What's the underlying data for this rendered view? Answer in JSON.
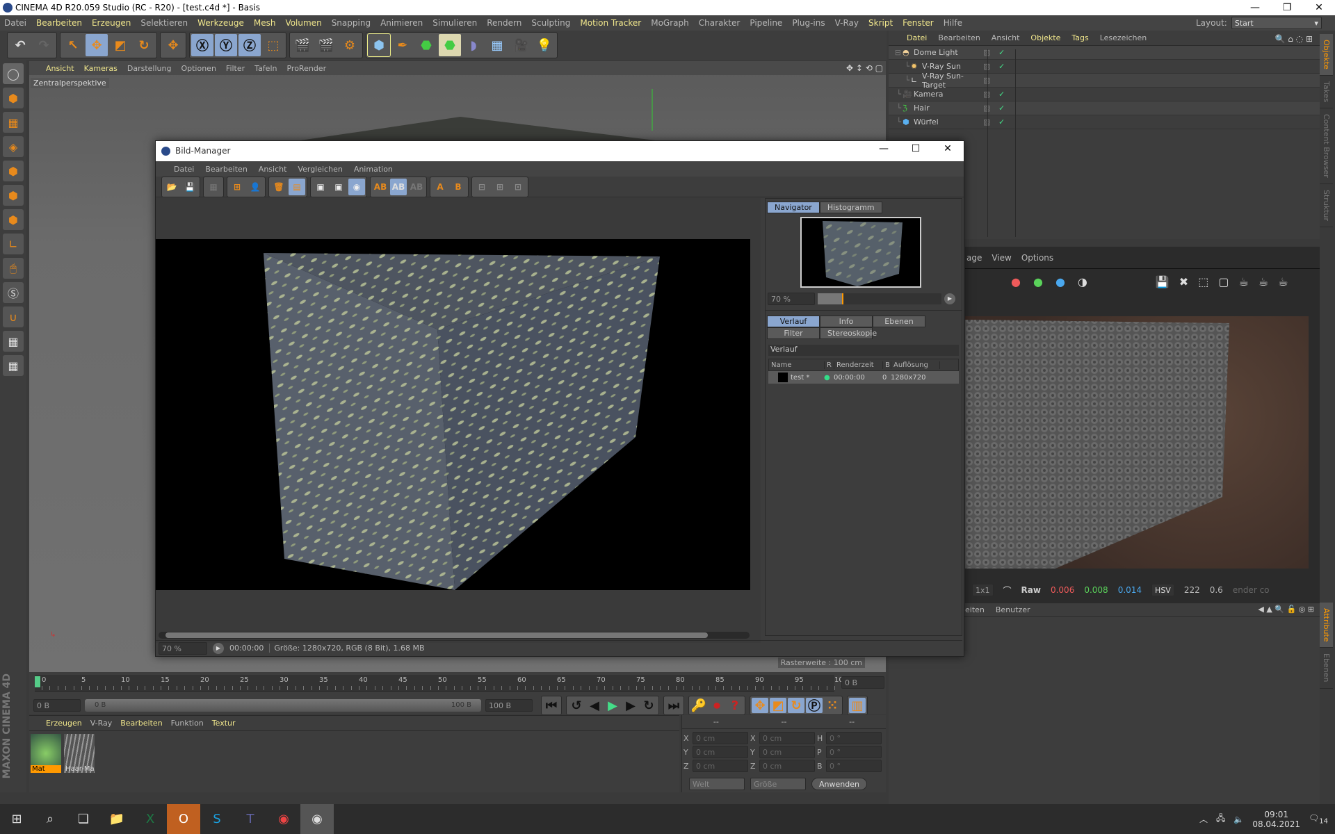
{
  "app": {
    "title": "CINEMA 4D R20.059 Studio (RC - R20) - [test.c4d *] - Basis",
    "layout_label": "Layout:",
    "layout_value": "Start"
  },
  "menu": [
    {
      "label": "Datei",
      "hl": false
    },
    {
      "label": "Bearbeiten",
      "hl": true
    },
    {
      "label": "Erzeugen",
      "hl": true
    },
    {
      "label": "Selektieren",
      "hl": false
    },
    {
      "label": "Werkzeuge",
      "hl": true
    },
    {
      "label": "Mesh",
      "hl": true
    },
    {
      "label": "Volumen",
      "hl": true
    },
    {
      "label": "Snapping",
      "hl": false
    },
    {
      "label": "Animieren",
      "hl": false
    },
    {
      "label": "Simulieren",
      "hl": false
    },
    {
      "label": "Rendern",
      "hl": false
    },
    {
      "label": "Sculpting",
      "hl": false
    },
    {
      "label": "Motion Tracker",
      "hl": true
    },
    {
      "label": "MoGraph",
      "hl": false
    },
    {
      "label": "Charakter",
      "hl": false
    },
    {
      "label": "Pipeline",
      "hl": false
    },
    {
      "label": "Plug-ins",
      "hl": false
    },
    {
      "label": "V-Ray",
      "hl": false
    },
    {
      "label": "Skript",
      "hl": true
    },
    {
      "label": "Fenster",
      "hl": true
    },
    {
      "label": "Hilfe",
      "hl": false
    }
  ],
  "viewport": {
    "menu": [
      {
        "label": "Ansicht",
        "hl": true
      },
      {
        "label": "Kameras",
        "hl": true
      },
      {
        "label": "Darstellung",
        "hl": false
      },
      {
        "label": "Optionen",
        "hl": false
      },
      {
        "label": "Filter",
        "hl": false
      },
      {
        "label": "Tafeln",
        "hl": false
      },
      {
        "label": "ProRender",
        "hl": false
      }
    ],
    "camera_label": "Zentralperspektive",
    "grid_label": "Rasterweite : 100 cm"
  },
  "objects": {
    "menu": [
      {
        "label": "Datei",
        "hl": true
      },
      {
        "label": "Bearbeiten",
        "hl": false
      },
      {
        "label": "Ansicht",
        "hl": false
      },
      {
        "label": "Objekte",
        "hl": true
      },
      {
        "label": "Tags",
        "hl": true
      },
      {
        "label": "Lesezeichen",
        "hl": false
      }
    ],
    "items": [
      {
        "name": "Dome Light",
        "icon": "dome-light-icon",
        "indent": 0
      },
      {
        "name": "V-Ray Sun",
        "icon": "sun-icon",
        "indent": 1
      },
      {
        "name": "V-Ray Sun-Target",
        "icon": "target-icon",
        "indent": 1
      },
      {
        "name": "Kamera",
        "icon": "camera-icon",
        "indent": 0
      },
      {
        "name": "Hair",
        "icon": "hair-icon",
        "indent": 0
      },
      {
        "name": "Würfel",
        "icon": "cube-icon",
        "indent": 0
      }
    ]
  },
  "side_tabs": [
    "Objekte",
    "Takes",
    "Content Browser",
    "Struktur"
  ],
  "side_tabs_lower": [
    "Attribute",
    "Ebenen"
  ],
  "vfb": {
    "menu": [
      "age",
      "View",
      "Options"
    ],
    "bottom": {
      "sample": "1x1",
      "raw": "Raw",
      "r": "0.006",
      "g": "0.008",
      "b": "0.014",
      "mode": "HSV",
      "h": "222",
      "v": "0.6",
      "status": "ender co"
    },
    "colors": {
      "r": "#ee5a5a",
      "g": "#5ad25a",
      "b": "#4aa8ee"
    }
  },
  "attributes": {
    "menu": [
      "eiten",
      "Benutzer"
    ]
  },
  "bildmanager": {
    "title": "Bild-Manager",
    "menu": [
      "Datei",
      "Bearbeiten",
      "Ansicht",
      "Vergleichen",
      "Animation"
    ],
    "nav_tabs": [
      "Navigator",
      "Histogramm"
    ],
    "nav_zoom": "70 %",
    "zoom_percent": 70,
    "tabs": [
      "Verlauf",
      "Info",
      "Ebenen",
      "Filter",
      "Stereoskopie"
    ],
    "section": "Verlauf",
    "columns": [
      "Name",
      "R",
      "Renderzeit",
      "B",
      "Auflösung"
    ],
    "rows": [
      {
        "name": "test *",
        "r": "●",
        "time": "00:00:00",
        "b": "0",
        "res": "1280x720"
      }
    ],
    "status": {
      "zoom": "70 %",
      "time": "00:00:00",
      "info": "Größe: 1280x720, RGB (8 Bit), 1.68 MB"
    }
  },
  "timeline": {
    "ticks": [
      "0",
      "5",
      "10",
      "15",
      "20",
      "25",
      "30",
      "35",
      "40",
      "45",
      "50",
      "55",
      "60",
      "65",
      "70",
      "75",
      "80",
      "85",
      "90",
      "95",
      "100"
    ],
    "current": "0 B",
    "start": "0 B",
    "range_start": "0 B",
    "range_end": "100 B",
    "end": "100 B"
  },
  "materials": {
    "menu": [
      {
        "label": "Erzeugen",
        "hl": true
      },
      {
        "label": "V-Ray",
        "hl": false
      },
      {
        "label": "Bearbeiten",
        "hl": true
      },
      {
        "label": "Funktion",
        "hl": false
      },
      {
        "label": "Textur",
        "hl": true
      }
    ],
    "items": [
      "Mat",
      "Haar-Ma"
    ]
  },
  "coords": {
    "headers": [
      "--",
      "--",
      "--"
    ],
    "rows": [
      [
        "X",
        "0 cm",
        "X",
        "0 cm",
        "H",
        "0 °"
      ],
      [
        "Y",
        "0 cm",
        "Y",
        "0 cm",
        "P",
        "0 °"
      ],
      [
        "Z",
        "0 cm",
        "Z",
        "0 cm",
        "B",
        "0 °"
      ]
    ],
    "sel1": "Welt",
    "sel2": "Größe",
    "apply": "Anwenden"
  },
  "brand": "MAXON CINEMA 4D",
  "taskbar": {
    "time": "09:01",
    "date": "08.04.2021",
    "notifications": "14"
  }
}
